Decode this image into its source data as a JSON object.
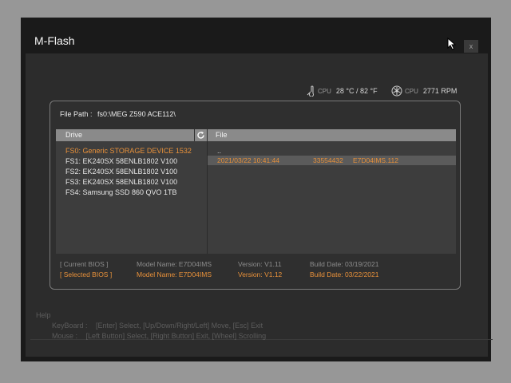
{
  "window": {
    "title": "M-Flash",
    "close_label": "x"
  },
  "status": {
    "cpu_temp_label": "CPU",
    "cpu_temp_value": "28 °C / 82 °F",
    "cpu_fan_label": "CPU",
    "cpu_fan_value": "2771 RPM"
  },
  "file_path": {
    "label": "File Path :",
    "value": "fs0:\\MEG Z590 ACE112\\"
  },
  "drives": {
    "header": "Drive",
    "items": [
      "FS0: Generic STORAGE DEVICE 1532",
      "FS1: EK240SX 58ENLB1802 V100",
      "FS2: EK240SX 58ENLB1802 V100",
      "FS3: EK240SX 58ENLB1802 V100",
      "FS4: Samsung SSD 860 QVO 1TB"
    ],
    "selected_index": 0
  },
  "files": {
    "header": "File",
    "parent": "..",
    "rows": [
      {
        "date": "2021/03/22 10:41:44",
        "size": "33554432",
        "name": "E7D04IMS.112"
      }
    ]
  },
  "bios": {
    "current": {
      "label": "[ Current BIOS ]",
      "model": "Model Name: E7D04IMS",
      "version": "Version: V1.11",
      "build": "Build Date: 03/19/2021"
    },
    "selected": {
      "label": "[ Selected BIOS ]",
      "model": "Model Name: E7D04IMS",
      "version": "Version: V1.12",
      "build": "Build Date: 03/22/2021"
    }
  },
  "help": {
    "title": "Help",
    "keyboard_label": "KeyBoard :",
    "keyboard_text": "[Enter] Select,  [Up/Down/Right/Left] Move,  [Esc] Exit",
    "mouse_label": "Mouse     :",
    "mouse_text": "[Left Button] Select,  [Right Button] Exit,  [Wheel] Scrolling"
  },
  "colors": {
    "accent": "#e8913a",
    "background": "#2c2c2c",
    "header": "#8a8a8a"
  }
}
